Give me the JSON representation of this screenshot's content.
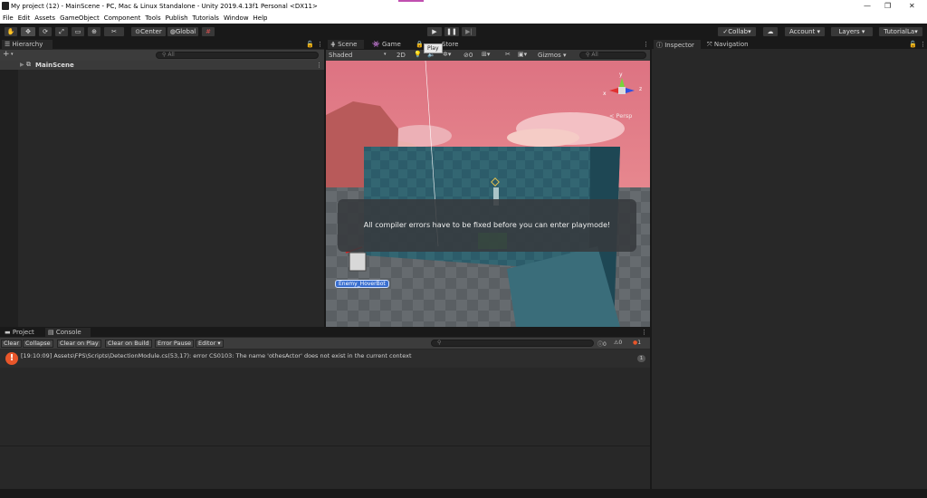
{
  "window": {
    "title": "My project (12) - MainScene - PC, Mac & Linux Standalone - Unity 2019.4.13f1 Personal <DX11>"
  },
  "menu": [
    "File",
    "Edit",
    "Assets",
    "GameObject",
    "Component",
    "Tools",
    "Publish",
    "Tutorials",
    "Window",
    "Help"
  ],
  "toolbar": {
    "center": "Center",
    "global": "Global",
    "collab": "Collab",
    "account": "Account",
    "layers": "Layers",
    "layout": "TutorialLa",
    "play_tooltip": "Play"
  },
  "hierarchy": {
    "tab": "Hierarchy",
    "search_placeholder": "All",
    "add": "+",
    "scene": "MainScene"
  },
  "scene": {
    "tab_scene": "Scene",
    "tab_game": "Game",
    "tab_store": "Store",
    "shading": "Shaded",
    "mode_2d": "2D",
    "gizmos": "Gizmos",
    "search_placeholder": "All",
    "persp": "Persp",
    "enemy_label": "Enemy_HoverBot",
    "playmode_message": "All compiler errors have to be fixed before you can enter playmode!",
    "axis_x": "x",
    "axis_y": "y",
    "axis_z": "z",
    "zero": "0"
  },
  "inspector": {
    "tab_inspector": "Inspector",
    "tab_navigation": "Navigation"
  },
  "bottom": {
    "tab_project": "Project",
    "tab_console": "Console"
  },
  "console": {
    "clear": "Clear",
    "collapse": "Collapse",
    "clear_on_play": "Clear on Play",
    "clear_on_build": "Clear on Build",
    "error_pause": "Error Pause",
    "editor": "Editor",
    "log_count": "0",
    "warn_count": "0",
    "error_count": "1",
    "entry": "[19:10:09] Assets\\FPS\\Scripts\\DetectionModule.cs(53,17): error CS0103: The name 'othesActor' does not exist in the current context",
    "entry_count": "1"
  },
  "colors": {
    "error": "#e8562a",
    "accent": "#3a72b0",
    "sky": "#e2828c"
  }
}
